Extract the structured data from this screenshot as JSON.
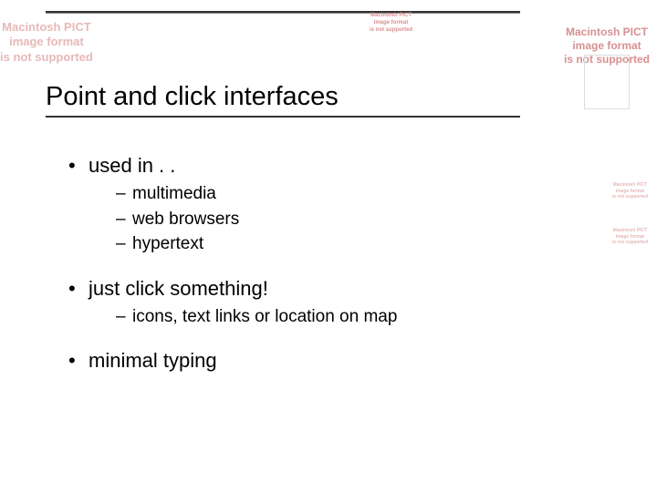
{
  "pict_error": {
    "line1": "Macintosh PICT",
    "line2": "image format",
    "line3": "is not supported"
  },
  "slide": {
    "title": "Point and click interfaces",
    "bullets": [
      {
        "text": "used in . .",
        "subs": [
          "multimedia",
          "web browsers",
          "hypertext"
        ]
      },
      {
        "text": "just click something!",
        "subs": [
          "icons, text links or location on map"
        ]
      },
      {
        "text": "minimal typing",
        "subs": []
      }
    ]
  }
}
